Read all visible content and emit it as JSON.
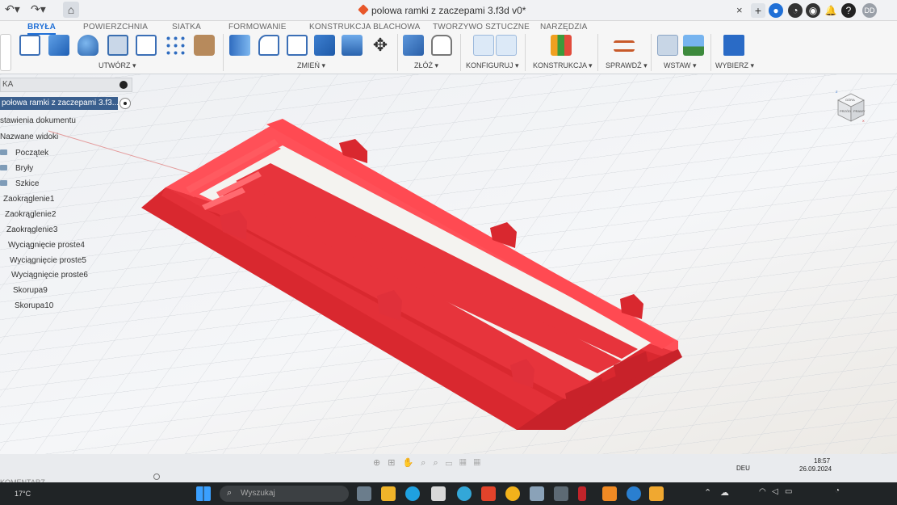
{
  "window": {
    "title": "polowa ramki z zaczepami 3.f3d v0*",
    "close_symbol": "×",
    "avatar_initials": "DD"
  },
  "ribbon": {
    "tabs": [
      "BRYŁA",
      "POWIERZCHNIA",
      "SIATKA",
      "FORMOWANIE",
      "KONSTRUKCJA BLACHOWA",
      "TWORZYWO SZTUCZNE",
      "NARZĘDZIA"
    ],
    "groups": [
      "UTWÓRZ ▾",
      "ZMIEŃ ▾",
      "ZŁÓŻ ▾",
      "KONFIGURUJ ▾",
      "KONSTRUKCJA ▾",
      "SPRAWDŹ ▾",
      "WSTAW ▾",
      "WYBIERZ ▾"
    ]
  },
  "browser": {
    "header": "KA",
    "document": "połowa ramki z zaczepami 3.f3...",
    "items": [
      "stawienia dokumentu",
      "Nazwane widoki",
      "Początek",
      "Bryły",
      "Szkice",
      "Zaokrąglenie1",
      "Zaokrąglenie2",
      "Zaokrąglenie3",
      "Wyciągnięcie proste4",
      "Wyciągnięcie proste5",
      "Wyciągnięcie proste6",
      "Skorupa9",
      "Skorupa10"
    ]
  },
  "viewcube": {
    "top": "GÓRA",
    "front": "PRZÓD",
    "side": "PRAWY",
    "axis_z": "Z",
    "axis_x": "X"
  },
  "bottom": {
    "comments": "KOMENTARZ"
  },
  "taskbar": {
    "weather": "17°C",
    "search_placeholder": "Wyszukaj",
    "language": "DEU",
    "time": "18:57",
    "date": "26.09.2024"
  },
  "colors": {
    "model": "#e8313a",
    "accent": "#1f6fd6",
    "browser_selected": "#3a5f8e"
  }
}
